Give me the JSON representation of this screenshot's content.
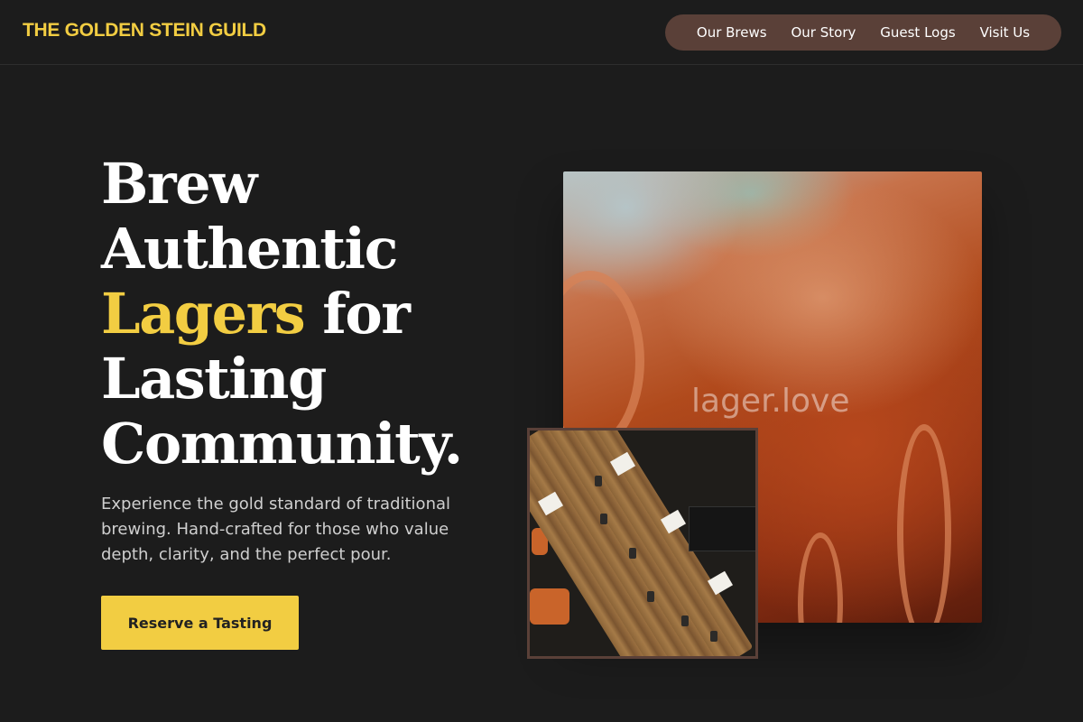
{
  "header": {
    "logo": "THE GOLDEN STEIN GUILD",
    "nav": [
      {
        "label": "Our Brews"
      },
      {
        "label": "Our Story"
      },
      {
        "label": "Guest Logs"
      },
      {
        "label": "Visit Us"
      }
    ]
  },
  "hero": {
    "title_part1": "Brew Authentic",
    "title_accent": "Lagers",
    "title_part2": "for Lasting Community.",
    "description": "Experience the gold standard of traditional brewing. Hand-crafted for those who value depth, clarity, and the perfect pour.",
    "cta_label": "Reserve a Tasting"
  },
  "images": {
    "watermark": "lager.love"
  },
  "colors": {
    "background": "#1c1c1c",
    "accent": "#f2cd42",
    "nav_pill": "#5a4038"
  }
}
